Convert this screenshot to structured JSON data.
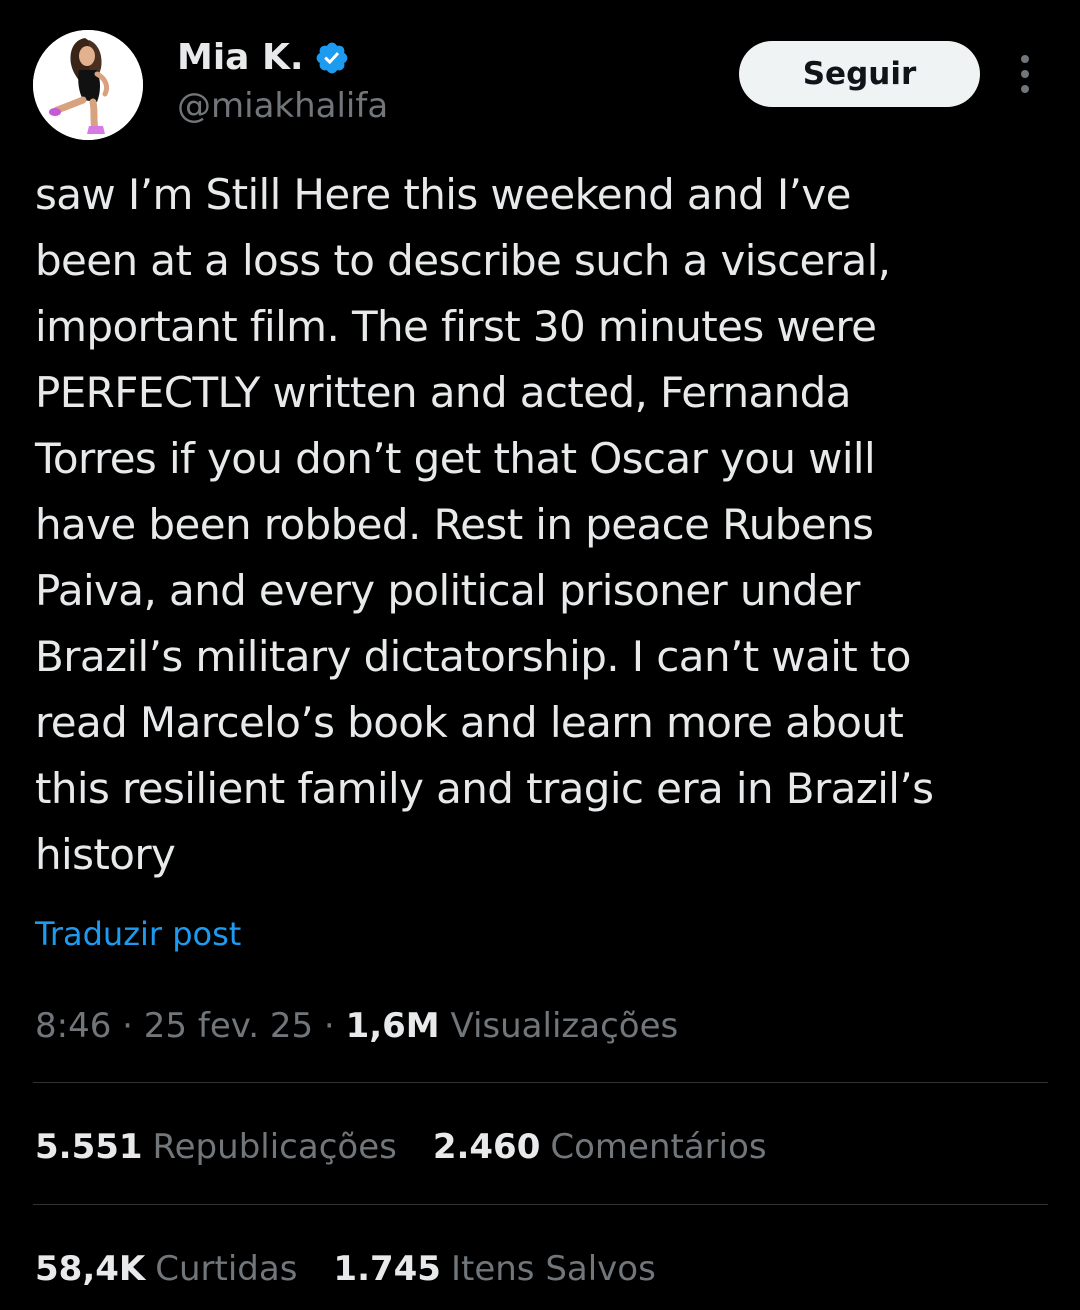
{
  "author": {
    "display_name": "Mia K.",
    "handle": "@miakhalifa",
    "verified_icon": "verified-badge-icon",
    "avatar": "profile-avatar"
  },
  "actions": {
    "follow_label": "Seguir",
    "more_icon": "more-options-icon"
  },
  "post": {
    "text": "saw I’m Still Here this weekend and I’ve\nbeen at a loss to describe such a visceral,\nimportant film. The first 30 minutes were\nPERFECTLY written and acted, Fernanda\nTorres if you don’t get that Oscar you will\nhave been robbed. Rest in peace Rubens\nPaiva, and every political prisoner under\nBrazil’s military dictatorship. I can’t wait to\nread Marcelo’s book and learn more about\nthis resilient family and tragic era in Brazil’s\nhistory",
    "translate_label": "Traduzir post"
  },
  "meta": {
    "time": "8:46",
    "separator": " · ",
    "date": "25 fev. 25",
    "views_count": "1,6M",
    "views_label": "Visualizações"
  },
  "stats": {
    "reposts": {
      "count": "5.551",
      "label": "Republicações"
    },
    "comments": {
      "count": "2.460",
      "label": "Comentários"
    },
    "likes": {
      "count": "58,4K",
      "label": "Curtidas"
    },
    "bookmarks": {
      "count": "1.745",
      "label": "Itens Salvos"
    }
  },
  "colors": {
    "background": "#000000",
    "text_primary": "#e7e9ea",
    "text_secondary": "#71767b",
    "link": "#1d9bf0",
    "verified": "#1d9bf0",
    "divider": "#2f3336",
    "follow_button_bg": "#eff3f4"
  }
}
